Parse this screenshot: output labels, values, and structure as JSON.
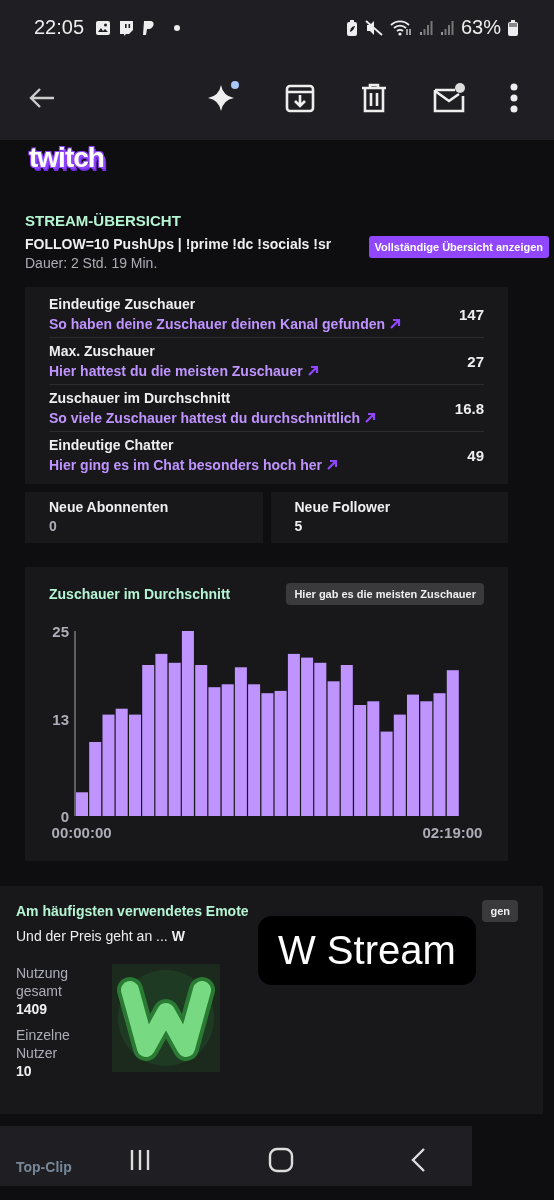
{
  "status_bar": {
    "time": "22:05",
    "battery": "63%"
  },
  "email": {
    "logo": "twitch",
    "section_label": "STREAM-ÜBERSICHT",
    "stream_title": "FOLLOW=10 PushUps | !prime !dc !socials !sr",
    "duration": "Dauer: 2 Std. 19 Min.",
    "overview_button": "Vollständige Übersicht anzeigen",
    "stats": [
      {
        "label": "Eindeutige Zuschauer",
        "link": "So haben deine Zuschauer deinen Kanal gefunden",
        "value": "147"
      },
      {
        "label": "Max. Zuschauer",
        "link": "Hier hattest du die meisten Zuschauer",
        "value": "27"
      },
      {
        "label": "Zuschauer im Durchschnitt",
        "link": "So viele Zuschauer hattest du durchschnittlich",
        "value": "16.8"
      },
      {
        "label": "Eindeutige Chatter",
        "link": "Hier ging es im Chat besonders hoch her",
        "value": "49"
      }
    ],
    "small_stats": [
      {
        "label": "Neue Abonnenten",
        "value": "0"
      },
      {
        "label": "Neue Follower",
        "value": "5"
      }
    ],
    "chart_card": {
      "title": "Zuschauer im Durchschnitt",
      "button": "Hier gab es die meisten Zuschauer",
      "chart_data": {
        "type": "bar",
        "categories": [
          "00:00:00",
          null,
          null,
          null,
          null,
          null,
          null,
          null,
          null,
          null,
          null,
          null,
          null,
          null,
          null,
          null,
          null,
          null,
          null,
          null,
          null,
          null,
          null,
          null,
          null,
          null,
          null,
          null,
          "02:19:00"
        ],
        "values": [
          3.2,
          10,
          13.7,
          14.5,
          13.7,
          20.4,
          21.9,
          20.7,
          25,
          20.4,
          17.4,
          17.8,
          20.1,
          17.8,
          16.6,
          16.9,
          21.9,
          21.4,
          20.7,
          18.2,
          20.4,
          15,
          15.5,
          11.4,
          13.7,
          16.4,
          15.5,
          16.6,
          19.7
        ],
        "ylim": [
          0,
          25
        ],
        "yticks": [
          0,
          13,
          25
        ]
      }
    },
    "emote_card": {
      "title": "Am häufigsten verwendetes Emote",
      "winner": "Und der Preis geht an ... **W**",
      "button": "gen",
      "stats": [
        {
          "label": "Nutzung gesamt",
          "value": "1409"
        },
        {
          "label": "Einzelne Nutzer",
          "value": "10"
        }
      ]
    },
    "next_card": {
      "title": "Top-Clip"
    }
  },
  "overlay_caption": "W Stream"
}
